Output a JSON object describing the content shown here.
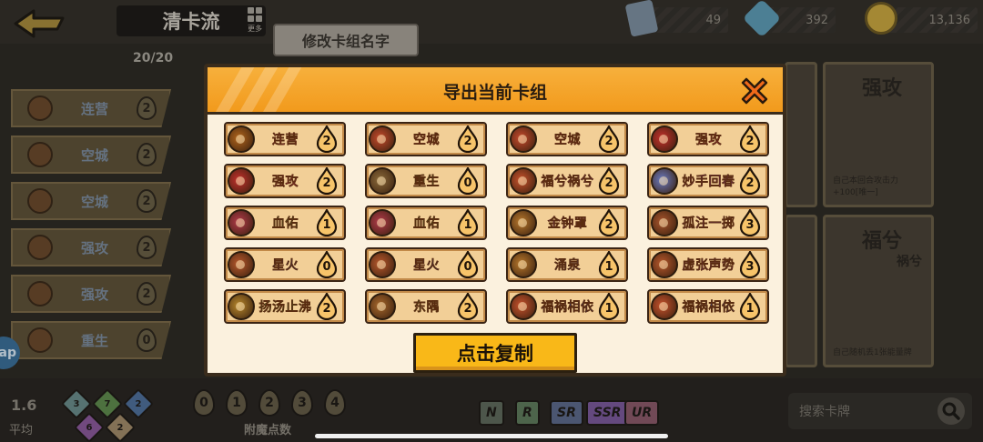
{
  "topbar": {
    "deck_title": "清卡流",
    "more_label": "更多",
    "rename_label": "修改卡组名字",
    "resources": [
      {
        "icon": "card-icon",
        "value": "49",
        "color": "#7d8fa0"
      },
      {
        "icon": "crystal-icon",
        "value": "392",
        "color": "#5d9bb5"
      },
      {
        "icon": "coin-icon",
        "value": "13,136",
        "color": "#c9a640"
      }
    ]
  },
  "deck_panel": {
    "count": "20/20",
    "items": [
      {
        "name": "连营",
        "cost": "2"
      },
      {
        "name": "空城",
        "cost": "2"
      },
      {
        "name": "空城",
        "cost": "2"
      },
      {
        "name": "强攻",
        "cost": "2"
      },
      {
        "name": "强攻",
        "cost": "2"
      },
      {
        "name": "重生",
        "cost": "0"
      }
    ]
  },
  "side_cards": [
    {
      "title": "强攻",
      "subtitle": "",
      "desc": "自己本回合攻击力+100[唯一]"
    },
    {
      "title": "福兮",
      "subtitle": "祸兮",
      "desc": "自己随机丢1张能量牌"
    }
  ],
  "ap_label": "ap",
  "bottom": {
    "average_value": "1.6",
    "average_label": "平均",
    "gems": [
      {
        "value": "3",
        "color": "#6a8c8a"
      },
      {
        "value": "7",
        "color": "#5e8a4e"
      },
      {
        "value": "2",
        "color": "#4f6f9a"
      },
      {
        "value": "6",
        "color": "#8a5a9a"
      },
      {
        "value": "2",
        "color": "#a08a6a"
      }
    ],
    "cost_filters": [
      "0",
      "1",
      "2",
      "3",
      "4"
    ],
    "cost_label": "附魔点数",
    "rarities": [
      {
        "label": "N",
        "color": "#5f6a5c"
      },
      {
        "label": "R",
        "color": "#5f7a5c"
      },
      {
        "label": "SR",
        "color": "#5c6a8a"
      },
      {
        "label": "SSR",
        "color": "#7a5a9a"
      },
      {
        "label": "UR",
        "color": "#8a5a6a"
      }
    ],
    "search_placeholder": "搜索卡牌"
  },
  "modal": {
    "title": "导出当前卡组",
    "copy_label": "点击复制",
    "accent": "#f29a1c",
    "cards": [
      {
        "name": "连营",
        "cost": "2",
        "color": "#d92b6a",
        "avatar": "#b2651c"
      },
      {
        "name": "空城",
        "cost": "2",
        "color": "#d92b6a",
        "avatar": "#c64a2c"
      },
      {
        "name": "空城",
        "cost": "2",
        "color": "#d92b6a",
        "avatar": "#c64a2c"
      },
      {
        "name": "强攻",
        "cost": "2",
        "color": "#d92b6a",
        "avatar": "#c4302c"
      },
      {
        "name": "强攻",
        "cost": "2",
        "color": "#d92b6a",
        "avatar": "#c4302c"
      },
      {
        "name": "重生",
        "cost": "0",
        "color": "#2f9a3f",
        "avatar": "#8b6a3a"
      },
      {
        "name": "福兮祸兮",
        "cost": "2",
        "color": "#8a34b8",
        "avatar": "#c8522c"
      },
      {
        "name": "妙手回春",
        "cost": "2",
        "color": "#8a34b8",
        "avatar": "#6a7ac0"
      },
      {
        "name": "血佑",
        "cost": "1",
        "color": "#2f9a3f",
        "avatar": "#b23a4a"
      },
      {
        "name": "血佑",
        "cost": "1",
        "color": "#2f9a3f",
        "avatar": "#b23a4a"
      },
      {
        "name": "金钟罩",
        "cost": "2",
        "color": "#8a34b8",
        "avatar": "#b8782c"
      },
      {
        "name": "孤注一掷",
        "cost": "3",
        "color": "#8a34b8",
        "avatar": "#a8542c"
      },
      {
        "name": "星火",
        "cost": "0",
        "color": "#2b3f8a",
        "avatar": "#b8582c"
      },
      {
        "name": "星火",
        "cost": "0",
        "color": "#2b3f8a",
        "avatar": "#b8582c"
      },
      {
        "name": "涌泉",
        "cost": "1",
        "color": "#2b5ab8",
        "avatar": "#b8782c"
      },
      {
        "name": "虚张声势",
        "cost": "3",
        "color": "#8a34b8",
        "avatar": "#b8582c"
      },
      {
        "name": "扬汤止沸",
        "cost": "2",
        "color": "#2f9a3f",
        "avatar": "#b8882c"
      },
      {
        "name": "东隅",
        "cost": "2",
        "color": "#2f9a3f",
        "avatar": "#a8682c"
      },
      {
        "name": "福祸相依",
        "cost": "1",
        "color": "#2b3f8a",
        "avatar": "#c8522c"
      },
      {
        "name": "福祸相依",
        "cost": "1",
        "color": "#2b3f8a",
        "avatar": "#c8522c"
      }
    ]
  }
}
